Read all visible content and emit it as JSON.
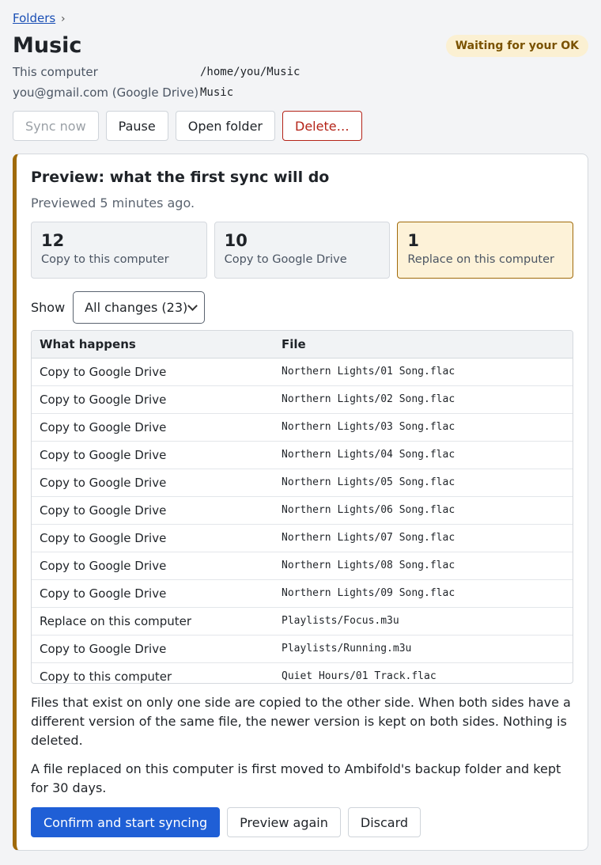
{
  "breadcrumb": {
    "link": "Folders",
    "separator": "›"
  },
  "title": "Music",
  "status_badge": "Waiting for your OK",
  "locations": [
    {
      "label": "This computer",
      "value": "/home/you/Music"
    },
    {
      "label": "you@gmail.com (Google Drive)",
      "value": "Music"
    }
  ],
  "toolbar": {
    "sync_now": "Sync now",
    "pause": "Pause",
    "open_folder": "Open folder",
    "delete": "Delete…"
  },
  "preview": {
    "heading": "Preview: what the first sync will do",
    "timestamp": "Previewed 5 minutes ago.",
    "stats": [
      {
        "count": "12",
        "label": "Copy to this computer"
      },
      {
        "count": "10",
        "label": "Copy to Google Drive"
      },
      {
        "count": "1",
        "label": "Replace on this computer"
      }
    ],
    "filter_label": "Show",
    "filter_value": "All changes (23)",
    "table": {
      "headers": [
        "What happens",
        "File"
      ],
      "rows": [
        {
          "action": "Copy to Google Drive",
          "file": "Northern Lights/01 Song.flac"
        },
        {
          "action": "Copy to Google Drive",
          "file": "Northern Lights/02 Song.flac"
        },
        {
          "action": "Copy to Google Drive",
          "file": "Northern Lights/03 Song.flac"
        },
        {
          "action": "Copy to Google Drive",
          "file": "Northern Lights/04 Song.flac"
        },
        {
          "action": "Copy to Google Drive",
          "file": "Northern Lights/05 Song.flac"
        },
        {
          "action": "Copy to Google Drive",
          "file": "Northern Lights/06 Song.flac"
        },
        {
          "action": "Copy to Google Drive",
          "file": "Northern Lights/07 Song.flac"
        },
        {
          "action": "Copy to Google Drive",
          "file": "Northern Lights/08 Song.flac"
        },
        {
          "action": "Copy to Google Drive",
          "file": "Northern Lights/09 Song.flac"
        },
        {
          "action": "Replace on this computer",
          "file": "Playlists/Focus.m3u"
        },
        {
          "action": "Copy to Google Drive",
          "file": "Playlists/Running.m3u"
        },
        {
          "action": "Copy to this computer",
          "file": "Quiet Hours/01 Track.flac"
        }
      ]
    },
    "note1": "Files that exist on only one side are copied to the other side. When both sides have a different version of the same file, the newer version is kept on both sides. Nothing is deleted.",
    "note2": "A file replaced on this computer is first moved to Ambifold's backup folder and kept for 30 days.",
    "confirm": "Confirm and start syncing",
    "preview_again": "Preview again",
    "discard": "Discard"
  },
  "colors": {
    "accent": "#1f5fd6",
    "warning": "#a06a0a",
    "danger": "#b42318",
    "badge_bg": "#fbf0d2"
  }
}
